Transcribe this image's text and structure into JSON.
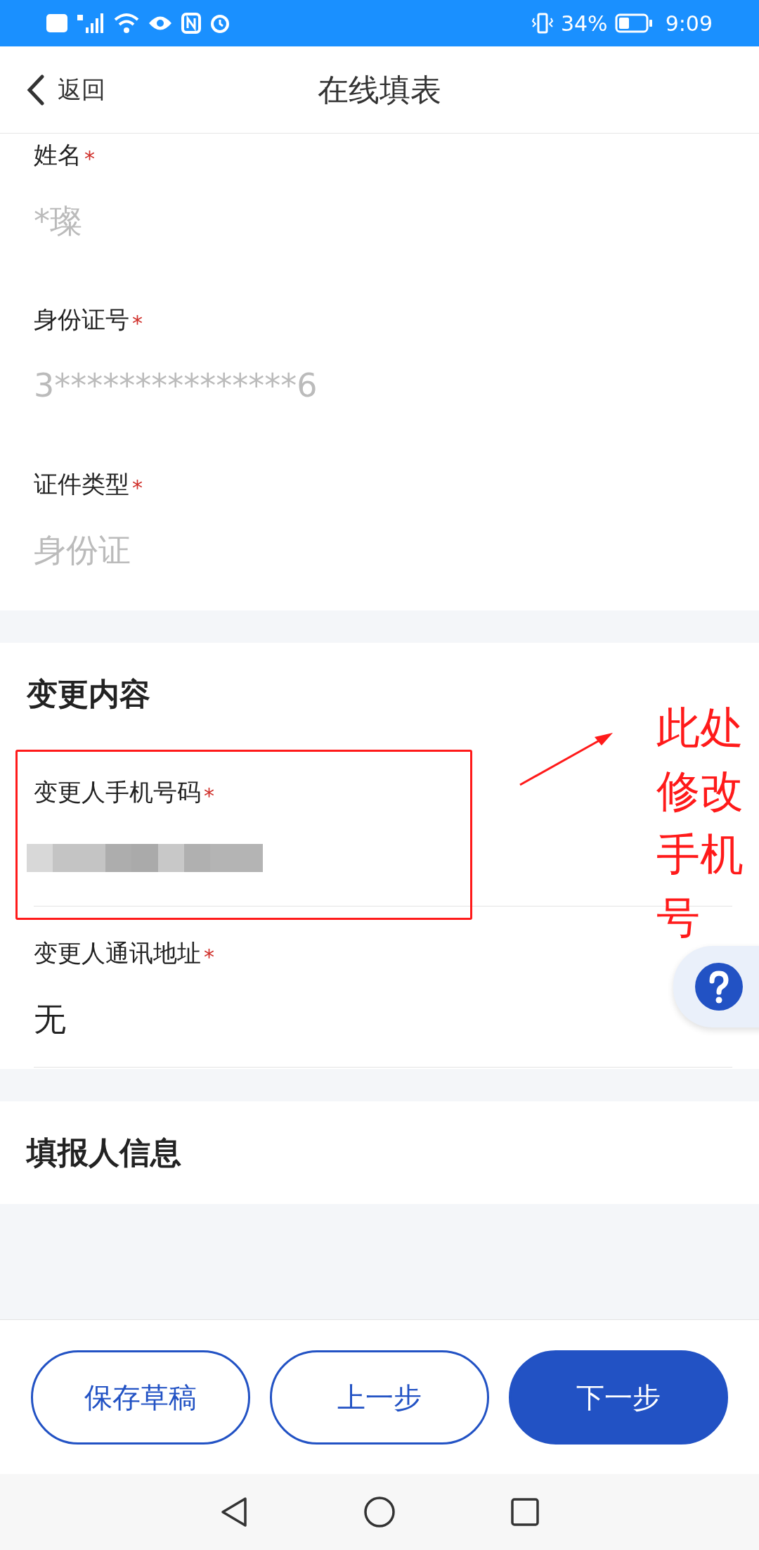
{
  "status_bar": {
    "battery_text": "34%",
    "time": "9:09"
  },
  "header": {
    "back_label": "返回",
    "title": "在线填表"
  },
  "sections": [
    {
      "fields": [
        {
          "label": "姓名",
          "required_mark": "*",
          "value": "*璨",
          "kind": "readonly",
          "highlighted": false
        },
        {
          "label": "身份证号",
          "required_mark": "*",
          "value": "3***************6",
          "kind": "readonly",
          "highlighted": false
        },
        {
          "label": "证件类型",
          "required_mark": "*",
          "value": "身份证",
          "kind": "readonly",
          "highlighted": false
        }
      ]
    },
    {
      "heading": "变更内容",
      "fields": [
        {
          "label": "变更人手机号码",
          "required_mark": "*",
          "kind": "blurred",
          "highlighted": true
        },
        {
          "label": "变更人通讯地址",
          "required_mark": "*",
          "value": "无",
          "kind": "editable",
          "highlighted": false
        }
      ]
    },
    {
      "heading": "填报人信息"
    }
  ],
  "annotation": {
    "note": [
      "此处",
      "修改",
      "手机",
      "号"
    ]
  },
  "buttons": [
    {
      "label": "保存草稿",
      "primary": false
    },
    {
      "label": "上一步",
      "primary": false
    },
    {
      "label": "下一步",
      "primary": true
    }
  ]
}
